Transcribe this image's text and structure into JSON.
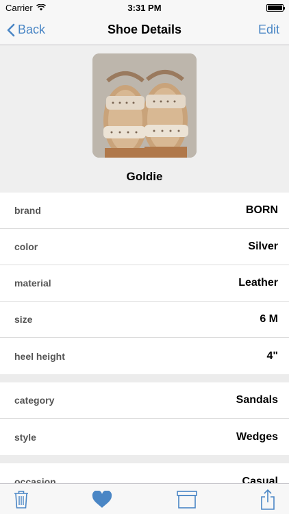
{
  "status_bar": {
    "carrier": "Carrier",
    "time": "3:31 PM"
  },
  "nav": {
    "back_label": "Back",
    "title": "Shoe Details",
    "edit_label": "Edit"
  },
  "shoe": {
    "name": "Goldie"
  },
  "details_group_1": [
    {
      "label": "brand",
      "value": "BORN"
    },
    {
      "label": "color",
      "value": "Silver"
    },
    {
      "label": "material",
      "value": "Leather"
    },
    {
      "label": "size",
      "value": "6 M"
    },
    {
      "label": "heel height",
      "value": "4\""
    }
  ],
  "details_group_2": [
    {
      "label": "category",
      "value": "Sandals"
    },
    {
      "label": "style",
      "value": "Wedges"
    }
  ],
  "details_group_3": [
    {
      "label": "occasion",
      "value": "Casual"
    }
  ],
  "toolbar": {
    "icons": [
      "trash-icon",
      "heart-icon",
      "archive-icon",
      "share-icon"
    ]
  },
  "colors": {
    "accent": "#4a86c5",
    "background": "#ececec"
  }
}
